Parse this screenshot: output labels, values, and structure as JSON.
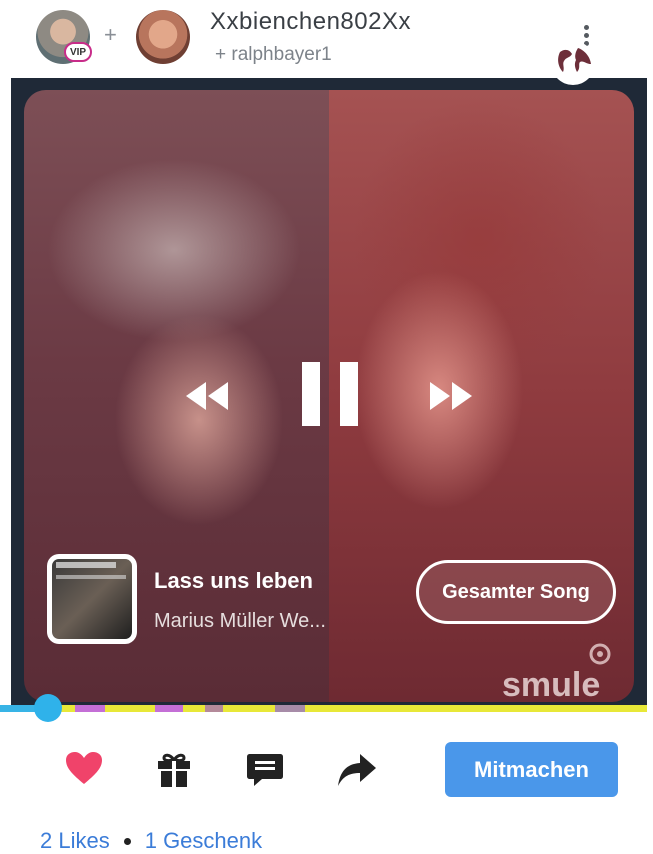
{
  "header": {
    "owner": "Xxbienchen802Xx",
    "partner": "+ ralphbayer1",
    "vip_badge": "VIP",
    "plus": "+"
  },
  "player": {
    "song_title": "Lass uns leben",
    "artist": "Marius Müller We...",
    "full_song_label": "Gesamter Song",
    "logo_text": "smule",
    "cover_text": "LASS UNS LEBEN",
    "progress_fraction": 0.06
  },
  "actions": {
    "join_label": "Mitmachen",
    "likes": "2 Likes",
    "gifts": "1 Geschenk"
  },
  "icons": [
    "more-icon",
    "globe-icon",
    "rewind-icon",
    "pause-icon",
    "forward-icon",
    "heart-icon",
    "gift-icon",
    "comment-icon",
    "share-icon"
  ],
  "colors": {
    "accent": "#4a97ea",
    "heart": "#f0436a",
    "progress": "#38b4e6",
    "track": "#e8e838"
  }
}
